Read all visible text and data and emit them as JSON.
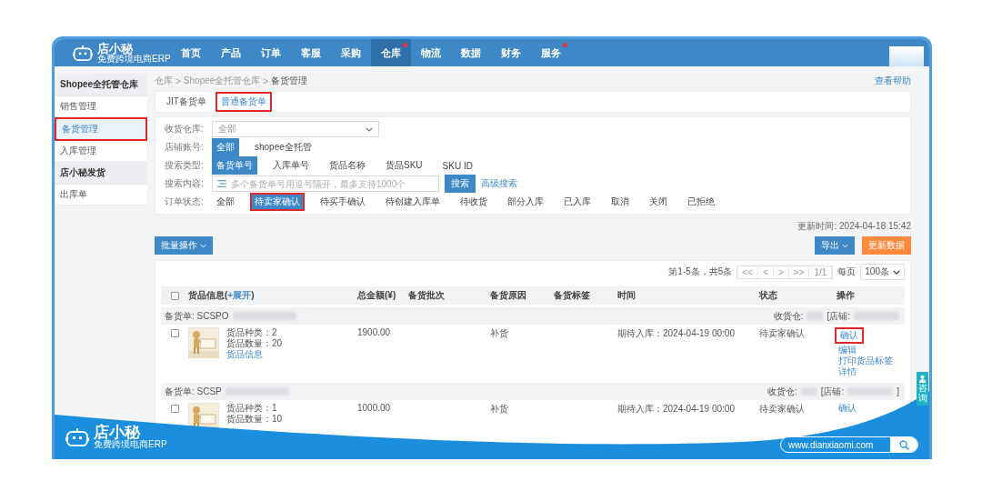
{
  "header": {
    "logo": {
      "name": "店小秘",
      "tagline": "免费跨境电商ERP"
    },
    "nav": [
      {
        "label": "首页",
        "selected": false,
        "dot": false
      },
      {
        "label": "产品",
        "selected": false,
        "dot": false
      },
      {
        "label": "订单",
        "selected": false,
        "dot": false
      },
      {
        "label": "客服",
        "selected": false,
        "dot": false
      },
      {
        "label": "采购",
        "selected": false,
        "dot": false
      },
      {
        "label": "仓库",
        "selected": true,
        "dot": true
      },
      {
        "label": "物流",
        "selected": false,
        "dot": false
      },
      {
        "label": "数据",
        "selected": false,
        "dot": false
      },
      {
        "label": "财务",
        "selected": false,
        "dot": false
      },
      {
        "label": "服务",
        "selected": false,
        "dot": true
      }
    ]
  },
  "sidebar": {
    "groups": [
      {
        "title": "Shopee全托管仓库",
        "items": [
          {
            "label": "销售管理",
            "selected": false,
            "highlighted": false
          },
          {
            "label": "备货管理",
            "selected": true,
            "highlighted": true
          },
          {
            "label": "入库管理",
            "selected": false,
            "highlighted": false
          }
        ]
      },
      {
        "title": "店小秘发货",
        "items": [
          {
            "label": "出库单",
            "selected": false,
            "highlighted": false
          }
        ]
      }
    ]
  },
  "breadcrumb": {
    "items": [
      "仓库",
      "Shopee全托管仓库",
      "备货管理"
    ],
    "separator": ">"
  },
  "help_link": "查看帮助",
  "tabs": [
    {
      "label": "JIT备货单",
      "selected": false,
      "highlighted": false
    },
    {
      "label": "普通备货单",
      "selected": true,
      "highlighted": true
    }
  ],
  "filters": [
    {
      "kind": "select",
      "label": "收货仓库:",
      "value": "全部"
    },
    {
      "kind": "options",
      "label": "店铺账号:",
      "options": [
        {
          "label": "全部",
          "selected": true,
          "highlighted": false
        },
        {
          "label": "shopee全托管",
          "selected": false,
          "highlighted": false
        }
      ]
    },
    {
      "kind": "options",
      "label": "搜索类型:",
      "options": [
        {
          "label": "备货单号",
          "selected": true,
          "highlighted": false
        },
        {
          "label": "入库单号",
          "selected": false,
          "highlighted": false
        },
        {
          "label": "货品名称",
          "selected": false,
          "highlighted": false
        },
        {
          "label": "货品SKU",
          "selected": false,
          "highlighted": false
        },
        {
          "label": "SKU ID",
          "selected": false,
          "highlighted": false
        }
      ]
    },
    {
      "kind": "search",
      "label": "搜索内容:",
      "placeholder": "多个备货单号用逗号隔开，最多支持1000个",
      "button": "搜索",
      "link": "高级搜索"
    },
    {
      "kind": "options",
      "label": "订单状态:",
      "options": [
        {
          "label": "全部",
          "selected": false,
          "highlighted": false
        },
        {
          "label": "待卖家确认",
          "selected": true,
          "highlighted": true
        },
        {
          "label": "待买手确认",
          "selected": false,
          "highlighted": false
        },
        {
          "label": "待创建入库单",
          "selected": false,
          "highlighted": false
        },
        {
          "label": "待收货",
          "selected": false,
          "highlighted": false
        },
        {
          "label": "部分入库",
          "selected": false,
          "highlighted": false
        },
        {
          "label": "已入库",
          "selected": false,
          "highlighted": false
        },
        {
          "label": "取消",
          "selected": false,
          "highlighted": false
        },
        {
          "label": "关闭",
          "selected": false,
          "highlighted": false
        },
        {
          "label": "已拒绝",
          "selected": false,
          "highlighted": false
        }
      ]
    }
  ],
  "updated": "更新时间: 2024-04-18 15:42",
  "toolbar": {
    "batch": "批量操作",
    "export": "导出",
    "refresh": "更新数据"
  },
  "pagination": {
    "summary": "第1-5条，共5条",
    "pages": [
      "<<",
      "<",
      ">",
      ">>",
      "1/1"
    ],
    "per_page_label": "每页",
    "per_page": "100条"
  },
  "table": {
    "select_all_checked": false,
    "columns": [
      {
        "label": "货品信息",
        "open": "(",
        "link": "+展开",
        "close": ")"
      },
      {
        "label": "总金额(¥)"
      },
      {
        "label": "备货批次"
      },
      {
        "label": "备货原因"
      },
      {
        "label": "备货标签"
      },
      {
        "label": "时间"
      },
      {
        "label": "状态"
      },
      {
        "label": "操作"
      }
    ],
    "orders": [
      {
        "order_label": "备货单:",
        "order_no": "SCSPO",
        "redacted": true,
        "checked": false,
        "warehouse_label": "收货仓:",
        "store_label": "[店铺:",
        "kinds": "货品种类：2",
        "qty": "货品数量：20",
        "info_link": "货品信息",
        "amount": "1900.00",
        "reason": "补货",
        "time": "期待入库：2024-04-19 00:00",
        "status": "待卖家确认",
        "actions": [
          {
            "label": "确认",
            "highlighted": true
          },
          {
            "label": "编辑",
            "highlighted": false
          },
          {
            "label": "打印货品标签",
            "highlighted": false
          },
          {
            "label": "详情",
            "highlighted": false
          }
        ]
      },
      {
        "order_label": "备货单:",
        "order_no": "SCSP",
        "redacted": true,
        "checked": false,
        "warehouse_label": "收货仓:",
        "store_label": "[店铺:",
        "store_close": "]",
        "kinds": "货品种类：1",
        "qty": "货品数量：10",
        "amount": "1000.00",
        "reason": "补货",
        "time": "期待入库：2024-04-19 00:00",
        "status": "待卖家确认",
        "actions": [
          {
            "label": "确认",
            "highlighted": false
          }
        ]
      }
    ]
  },
  "consult_tab": "咨询",
  "banner": {
    "logo": {
      "name": "店小秘",
      "tagline": "免费跨境电商ERP"
    },
    "url": "www.dianxiaomi.com"
  }
}
